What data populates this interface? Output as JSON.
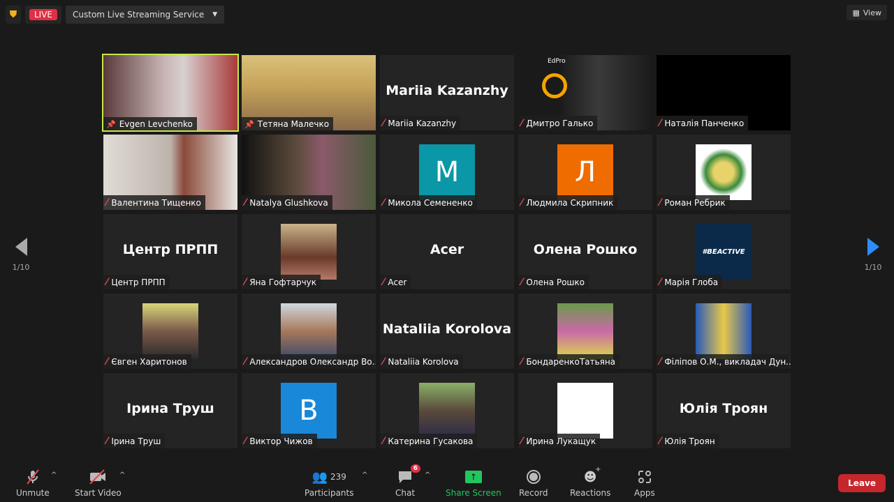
{
  "header": {
    "live_label": "LIVE",
    "stream_label": "Custom Live Streaming Service",
    "view_label": "View"
  },
  "pagination": {
    "left": "1/10",
    "right": "1/10"
  },
  "tiles": [
    {
      "name": "Evgen Levchenko",
      "type": "video",
      "bg": "linear-gradient(90deg,#5a3a3a,#c8b4b4 45%,#d8d0d0 60%,#a83a3a)",
      "pinned": true,
      "active": true
    },
    {
      "name": "Тетяна Малечко",
      "type": "video",
      "bg": "linear-gradient(180deg,#d9c07a,#c7a55a 40%,#8a6a4a)",
      "pinned": true
    },
    {
      "name": "Mariia Kazanzhy",
      "type": "text"
    },
    {
      "name": "Дмитро Галько",
      "type": "video",
      "bg": "linear-gradient(90deg,#1a1a1a 30%,#3a3a3a 60%,#1a1a1a)",
      "extra": "EdPro"
    },
    {
      "name": "Наталія Панченко",
      "type": "video",
      "bg": "#000"
    },
    {
      "name": "Валентина Тищенко",
      "type": "video",
      "bg": "linear-gradient(90deg,#e0dcd6,#bdb4ac 50%,#8a4a3a 60%,#e8e6e2)"
    },
    {
      "name": "Natalya Glushkova",
      "type": "video",
      "bg": "linear-gradient(90deg,#111,#5a4a3a 40%,#8a5a6a 60%,#4a5a3a)"
    },
    {
      "name": "Микола Семененко",
      "type": "letter",
      "letter": "M",
      "color": "#0a97a7"
    },
    {
      "name": "Людмила Скрипник",
      "type": "letter",
      "letter": "Л",
      "color": "#ef6c00"
    },
    {
      "name": "Роман Ребрик",
      "type": "image",
      "color": "radial-gradient(circle,#e8d36a 25%,#3a8a3a 45%,#fff 60%)"
    },
    {
      "name": "Центр ПРПП",
      "type": "text"
    },
    {
      "name": "Яна Гофтарчук",
      "type": "image",
      "color": "linear-gradient(180deg,#c9b48a,#6a3a2a 60%,#b47a6a)"
    },
    {
      "name": "Acer",
      "type": "text"
    },
    {
      "name": "Олена Рошко",
      "type": "text"
    },
    {
      "name": "Марія Глоба",
      "type": "image",
      "color": "#0b2a4a",
      "extra": "#BEACTIVE"
    },
    {
      "name": "Євген Харитонов",
      "type": "image",
      "color": "linear-gradient(180deg,#d8d67a,#7a5a4a 50%,#2a2a2a)"
    },
    {
      "name": "Александров Олександр Во...",
      "type": "image",
      "color": "linear-gradient(180deg,#d0d8e0,#a8785a 50%,#3a4a6a)"
    },
    {
      "name": "Nataliia Korolova",
      "type": "text"
    },
    {
      "name": "БондаренкоТатьяна",
      "type": "image",
      "color": "linear-gradient(180deg,#6a9a4a,#c86aa8 50%,#dada4a)"
    },
    {
      "name": "Філіпов О.М., викладач Дун...",
      "type": "image",
      "color": "linear-gradient(90deg,#2a5ab8,#e8c84a 50%,#2a5ab8)"
    },
    {
      "name": "Ірина Труш",
      "type": "text"
    },
    {
      "name": "Виктор Чижов",
      "type": "letter",
      "letter": "B",
      "color": "#1a88d8"
    },
    {
      "name": "Катерина Гусакова",
      "type": "image",
      "color": "linear-gradient(180deg,#8ab06a,#5a4a3a 50%,#2a2a4a)"
    },
    {
      "name": "Ирина Лукащук",
      "type": "image",
      "color": "#fff"
    },
    {
      "name": "Юлія Троян",
      "type": "text"
    }
  ],
  "toolbar": {
    "unmute": "Unmute",
    "start_video": "Start Video",
    "participants": "Participants",
    "participants_count": "239",
    "chat": "Chat",
    "chat_badge": "6",
    "share_screen": "Share Screen",
    "record": "Record",
    "reactions": "Reactions",
    "apps": "Apps",
    "leave": "Leave"
  },
  "colors": {
    "accent": "#2d8cff",
    "share": "#22c55e",
    "leave": "#c6272d",
    "live": "#e02f44",
    "active_speaker": "#c6e94a"
  }
}
